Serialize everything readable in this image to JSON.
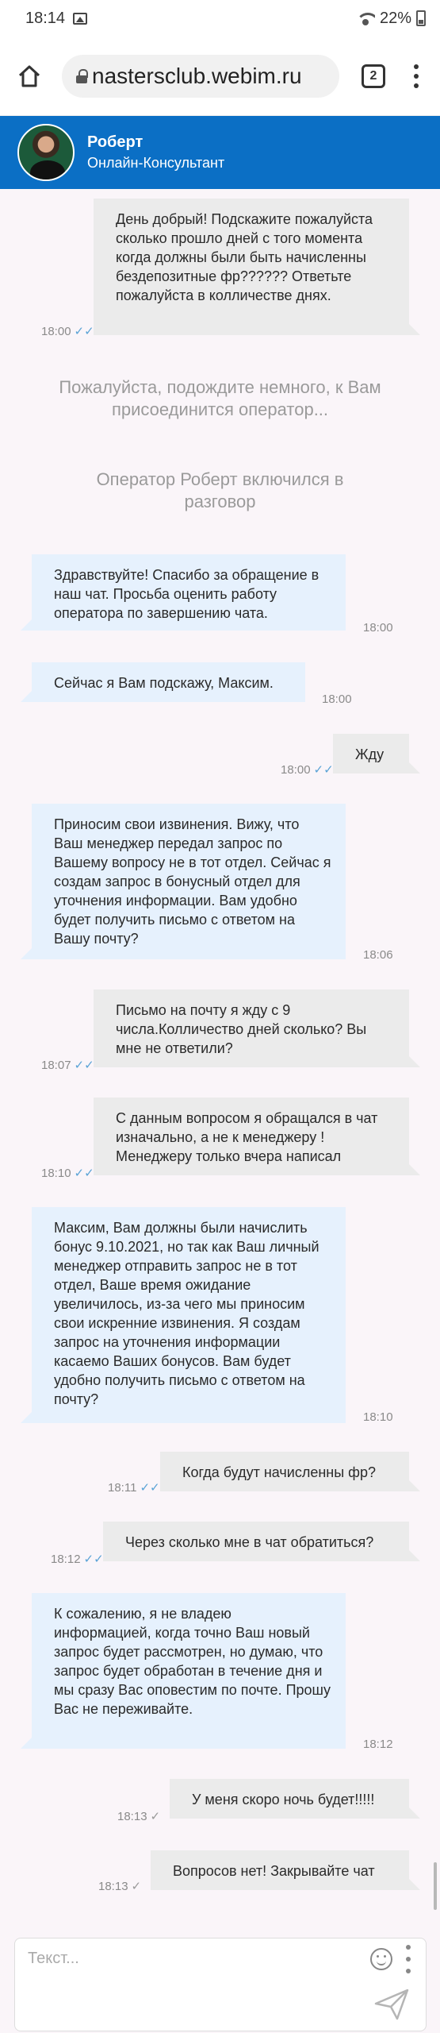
{
  "status_bar": {
    "time": "18:14",
    "battery": "22%"
  },
  "browser": {
    "url": "nastersclub.webim.ru",
    "tab_count": "2"
  },
  "chat_header": {
    "name": "Роберт",
    "role": "Онлайн-Консультант"
  },
  "messages": [
    {
      "text": "День добрый! Подскажите пожалуйста сколько прошло дней с того момента когда должны были быть начисленны бездепозитные фр?????? Ответьте пожалуйста в колличестве днях.",
      "time": "18:00"
    },
    {
      "text": "Пожалуйста, подождите немного, к Вам присоединится оператор..."
    },
    {
      "text": "Оператор Роберт включился в разговор"
    },
    {
      "text": "Здравствуйте! Спасибо за обращение в наш чат. Просьба оценить работу оператора по завершению чата.",
      "time": "18:00"
    },
    {
      "text": "Сейчас я Вам подскажу, Максим.",
      "time": "18:00"
    },
    {
      "text": "Жду",
      "time": "18:00"
    },
    {
      "text": "Приносим свои извинения. Вижу, что Ваш менеджер передал запрос по Вашему вопросу не в тот отдел. Сейчас я создам запрос в бонусный отдел для уточнения информации. Вам удобно будет получить письмо с ответом на Вашу почту?",
      "time": "18:06"
    },
    {
      "text": "Письмо на почту я жду с 9 числа.Колличество дней сколько? Вы мне не ответили?",
      "time": "18:07"
    },
    {
      "text": "С данным вопросом я обращался в чат изначально, а не к менеджеру ! Менеджеру только вчера написал",
      "time": "18:10"
    },
    {
      "text": "Максим, Вам должны были начислить бонус 9.10.2021, но так как Ваш личный менеджер отправить запрос не в тот отдел, Ваше время ожидание увеличилось, из-за чего мы приносим свои искренние извинения. Я создам запрос на уточнения информации касаемо Ваших бонусов. Вам будет удобно получить письмо с ответом на почту?",
      "time": "18:10"
    },
    {
      "text": "Когда будут начисленны фр?",
      "time": "18:11"
    },
    {
      "text": "Через сколько мне в чат обратиться?",
      "time": "18:12"
    },
    {
      "text": "К сожалению, я не владею информацией, когда точно Ваш новый запрос будет рассмотрен, но думаю, что запрос будет обработан в течение дня и мы сразу Вас оповестим по почте. Прошу Вас не переживайте.",
      "time": "18:12"
    },
    {
      "text": "У меня скоро ночь будет!!!!!",
      "time": "18:13"
    },
    {
      "text": "Вопросов нет! Закрывайте чат",
      "time": "18:13"
    }
  ],
  "input": {
    "placeholder": "Текст..."
  }
}
